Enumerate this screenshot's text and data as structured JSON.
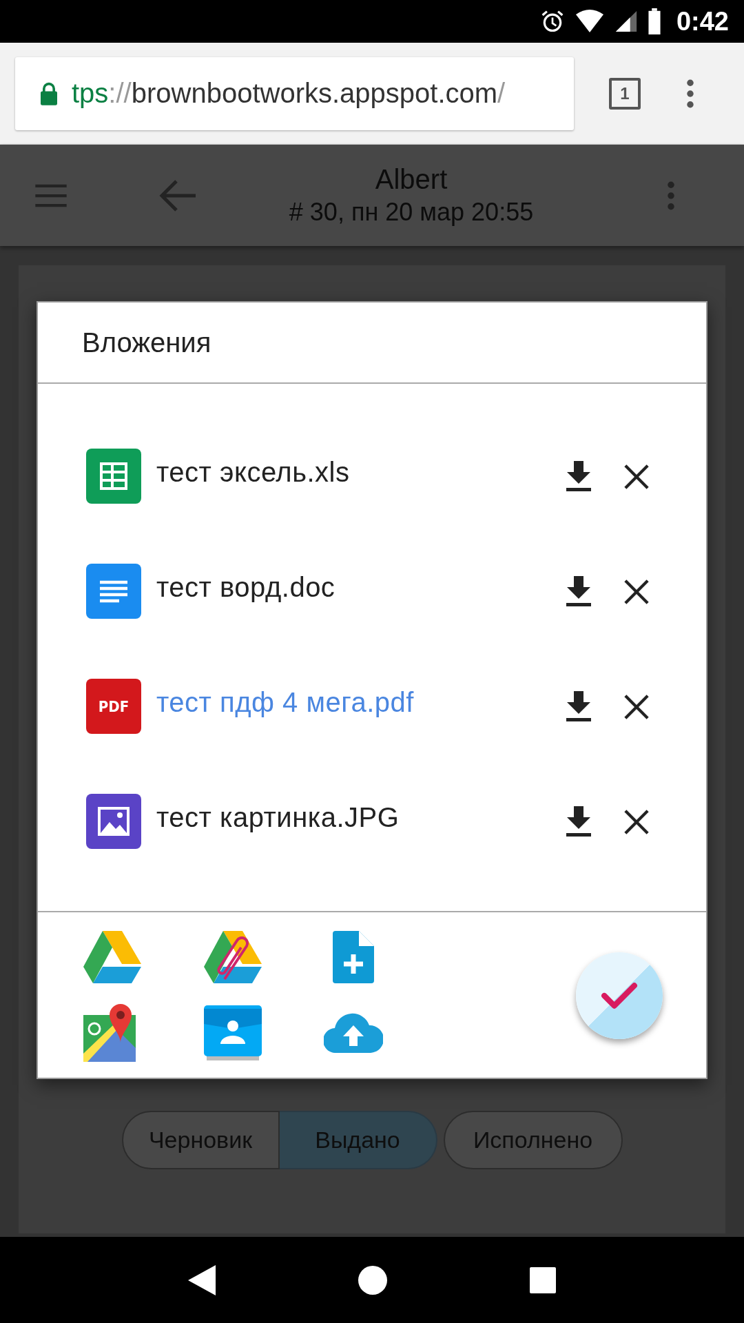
{
  "status_bar": {
    "time": "0:42"
  },
  "browser": {
    "url": {
      "scheme": "tps",
      "separator": "://",
      "host": "brownbootworks.appspot.com",
      "path": "/"
    },
    "tab_count": "1"
  },
  "app_bar": {
    "title": "Albert",
    "subtitle": "# 30, пн 20 мар 20:55"
  },
  "dialog": {
    "title": "Вложения",
    "attachments": [
      {
        "kind": "sheet",
        "name": "тест эксель.xls",
        "linked": false
      },
      {
        "kind": "doc",
        "name": "тест ворд.doc",
        "linked": false
      },
      {
        "kind": "pdf",
        "name": "тест пдф 4 мега.pdf",
        "linked": true,
        "badge": "PDF"
      },
      {
        "kind": "image",
        "name": "тест картинка.JPG",
        "linked": false
      }
    ]
  },
  "status_chips": [
    {
      "label": "Черновик",
      "selected": false
    },
    {
      "label": "Выдано",
      "selected": true
    },
    {
      "label": "Исполнено",
      "selected": false
    }
  ]
}
